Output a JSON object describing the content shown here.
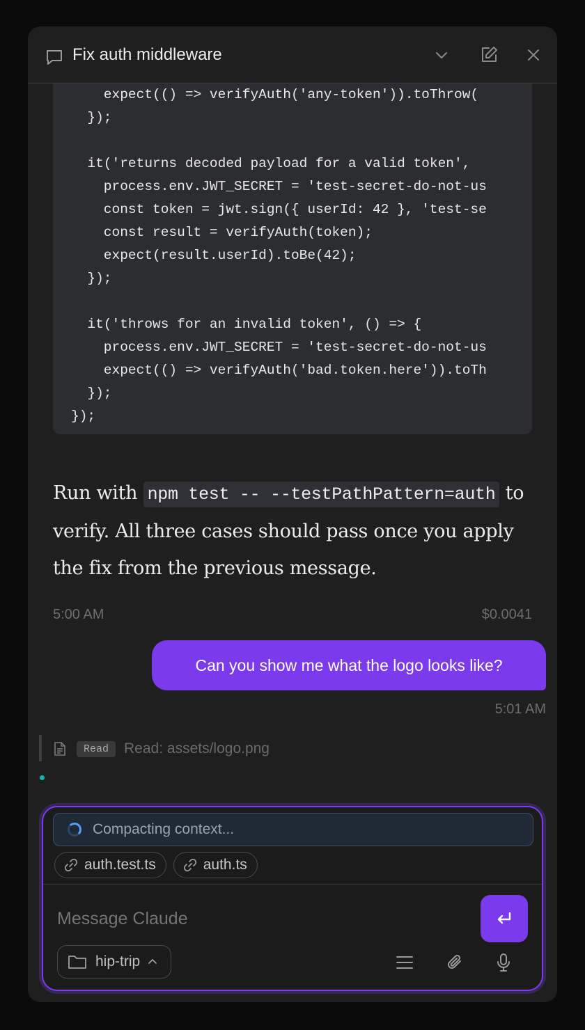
{
  "header": {
    "title": "Fix auth middleware"
  },
  "code": {
    "lines": [
      "    expect(() => verifyAuth('any-token')).toThrow(",
      "  });",
      "",
      "  it('returns decoded payload for a valid token', ",
      "    process.env.JWT_SECRET = 'test-secret-do-not-us",
      "    const token = jwt.sign({ userId: 42 }, 'test-se",
      "    const result = verifyAuth(token);",
      "    expect(result.userId).toBe(42);",
      "  });",
      "",
      "  it('throws for an invalid token', () => {",
      "    process.env.JWT_SECRET = 'test-secret-do-not-us",
      "    expect(() => verifyAuth('bad.token.here')).toTh",
      "  });",
      "});"
    ]
  },
  "assistant_message": {
    "prefix": "Run with ",
    "command": "npm test -- --testPathPattern=auth",
    "suffix": " to verify. All three cases should pass once you apply the fix from the previous message.",
    "time": "5:00 AM",
    "cost": "$0.0041"
  },
  "user_message": {
    "text": "Can you show me what the logo looks like?",
    "time": "5:01 AM"
  },
  "tool_call": {
    "badge": "Read",
    "text": "Read: assets/logo.png"
  },
  "composer": {
    "status": "Compacting context...",
    "chips": [
      "auth.test.ts",
      "auth.ts"
    ],
    "placeholder": "Message Claude",
    "folder": "hip-trip"
  },
  "colors": {
    "accent": "#7c3aed",
    "panel_bg": "#1f1f1f",
    "code_bg": "#2b2d31",
    "status_dot": "#14b8a6"
  }
}
